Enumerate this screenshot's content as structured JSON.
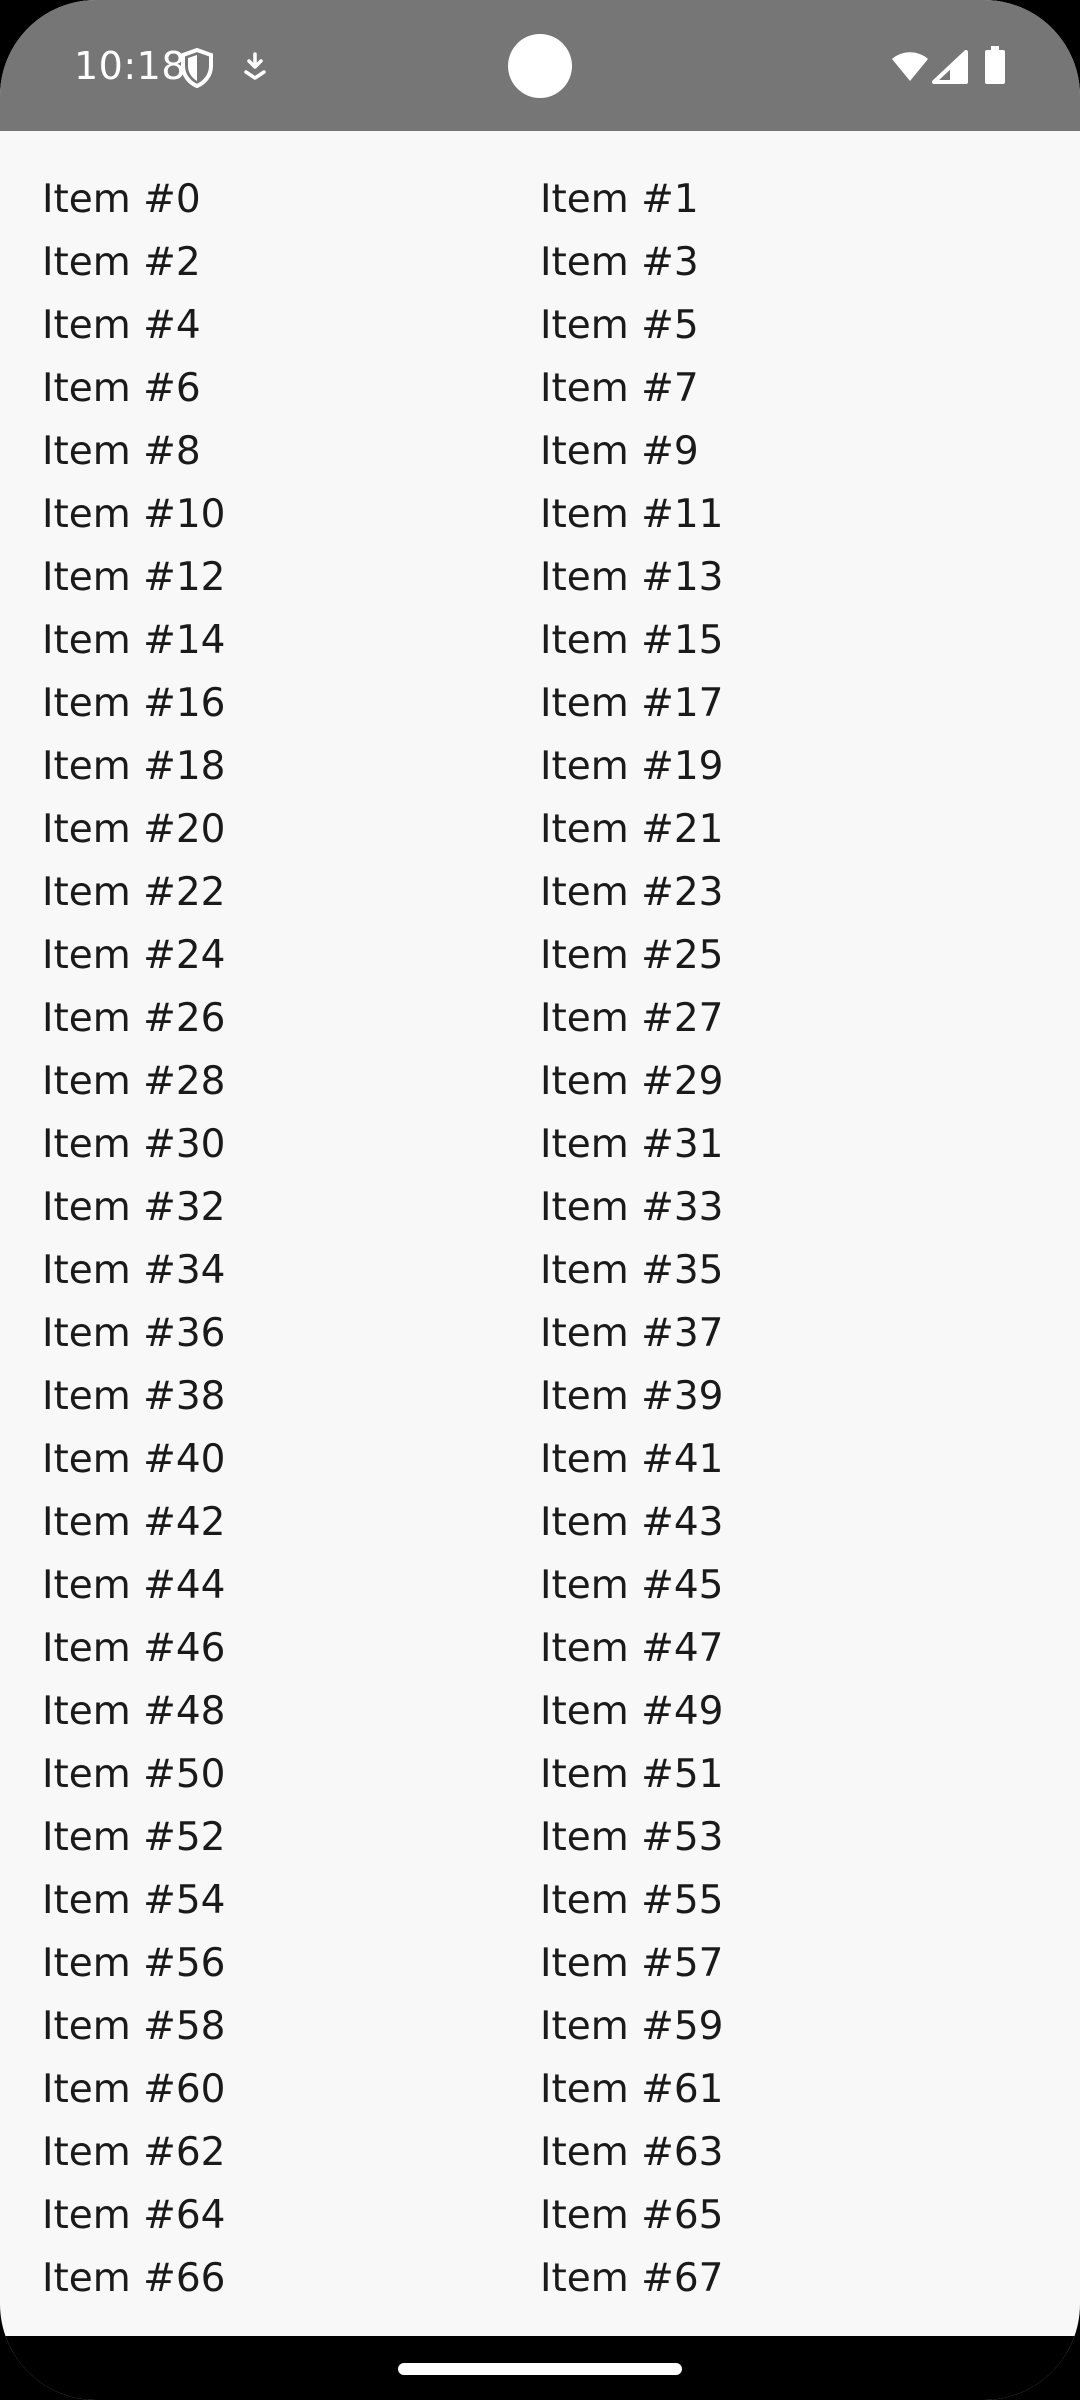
{
  "status_bar": {
    "time": "10:18",
    "left_icons": [
      "shield-icon",
      "download-icon"
    ],
    "right_icons": [
      "wifi-icon",
      "cell-signal-icon",
      "battery-icon"
    ],
    "background_color": "#767676"
  },
  "list": {
    "items": [
      "Item #0",
      "Item #1",
      "Item #2",
      "Item #3",
      "Item #4",
      "Item #5",
      "Item #6",
      "Item #7",
      "Item #8",
      "Item #9",
      "Item #10",
      "Item #11",
      "Item #12",
      "Item #13",
      "Item #14",
      "Item #15",
      "Item #16",
      "Item #17",
      "Item #18",
      "Item #19",
      "Item #20",
      "Item #21",
      "Item #22",
      "Item #23",
      "Item #24",
      "Item #25",
      "Item #26",
      "Item #27",
      "Item #28",
      "Item #29",
      "Item #30",
      "Item #31",
      "Item #32",
      "Item #33",
      "Item #34",
      "Item #35",
      "Item #36",
      "Item #37",
      "Item #38",
      "Item #39",
      "Item #40",
      "Item #41",
      "Item #42",
      "Item #43",
      "Item #44",
      "Item #45",
      "Item #46",
      "Item #47",
      "Item #48",
      "Item #49",
      "Item #50",
      "Item #51",
      "Item #52",
      "Item #53",
      "Item #54",
      "Item #55",
      "Item #56",
      "Item #57",
      "Item #58",
      "Item #59",
      "Item #60",
      "Item #61",
      "Item #62",
      "Item #63",
      "Item #64",
      "Item #65",
      "Item #66",
      "Item #67"
    ]
  }
}
